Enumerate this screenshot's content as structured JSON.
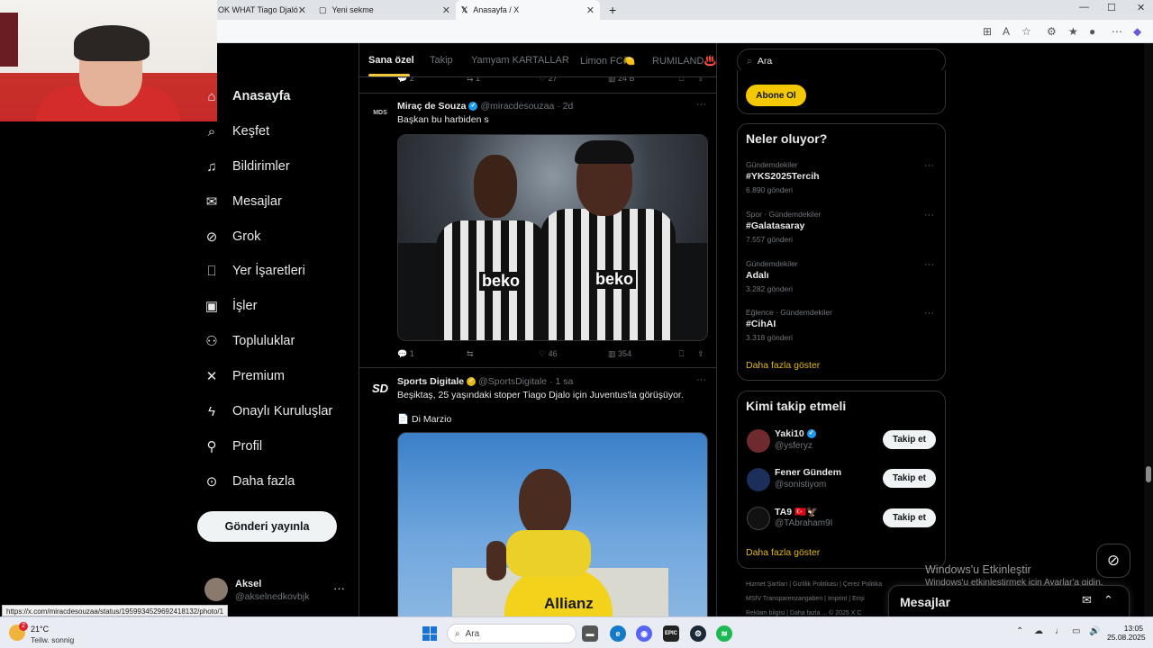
{
  "browser": {
    "tabs": [
      {
        "label": "OK WHAT Tiago Djaló is ..."
      },
      {
        "label": "Yeni sekme"
      },
      {
        "label": "Anasayfa / X"
      }
    ],
    "new_tab": "+",
    "window_controls": [
      "—",
      "☐",
      "✕"
    ]
  },
  "sidebar": {
    "logo": "X",
    "items": [
      {
        "label": "Anasayfa",
        "icon": "home-icon"
      },
      {
        "label": "Keşfet",
        "icon": "search-icon"
      },
      {
        "label": "Bildirimler",
        "icon": "bell-icon"
      },
      {
        "label": "Mesajlar",
        "icon": "mail-icon"
      },
      {
        "label": "Grok",
        "icon": "grok-icon"
      },
      {
        "label": "Yer İşaretleri",
        "icon": "bookmark-icon"
      },
      {
        "label": "İşler",
        "icon": "briefcase-icon"
      },
      {
        "label": "Topluluklar",
        "icon": "people-icon"
      },
      {
        "label": "Premium",
        "icon": "x-logo-icon"
      },
      {
        "label": "Onaylı Kuruluşlar",
        "icon": "lightning-icon"
      },
      {
        "label": "Profil",
        "icon": "person-icon"
      },
      {
        "label": "Daha fazla",
        "icon": "more-circle-icon"
      }
    ],
    "post_button": "Gönderi yayınla",
    "account": {
      "name": "Aksel",
      "handle": "@akselnedkovbjk",
      "more": "···"
    }
  },
  "status_url": "https://x.com/miracdesouzaa/status/1959934529692418132/photo/1",
  "feed": {
    "tabs": [
      {
        "label": "Sana özel",
        "active": true
      },
      {
        "label": "Takip"
      },
      {
        "label": "Yamyam KARTALLAR"
      },
      {
        "label": "Limon FC🍋"
      },
      {
        "label": "RUMILAND♨️"
      }
    ],
    "prev_actions": {
      "replies": "2",
      "reposts": "1",
      "likes": "27",
      "views": "24 B"
    },
    "tweets": [
      {
        "avatar": "MDS",
        "name": "Miraç de Souza",
        "handle": "@miracdesouzaa",
        "time": "2d",
        "text": "Başkan bu harbiden s",
        "actions": {
          "replies": "1",
          "reposts": "",
          "likes": "46",
          "views": "354"
        }
      },
      {
        "avatar": "SD",
        "name": "Sports Digitale",
        "handle": "@SportsDigitale",
        "time": "1 sa",
        "text": "Beşiktaş, 25 yaşındaki stoper Tiago Djalo için Juventus'la görüşüyor.",
        "source": "📄 Di Marzio"
      }
    ],
    "media_text": {
      "sponsor": "beko",
      "sponsor2": "beko",
      "j_sponsor": "Allianz"
    }
  },
  "right": {
    "search_placeholder": "Ara",
    "subscribe_button": "Abone Ol",
    "trends_title": "Neler oluyor?",
    "trends": [
      {
        "category": "Gündemdekiler",
        "name": "#YKS2025Tercih",
        "count": "6.890 gönderi"
      },
      {
        "category": "Spor · Gündemdekiler",
        "name": "#Galatasaray",
        "count": "7.557 gönderi"
      },
      {
        "category": "Gündemdekiler",
        "name": "Adalı",
        "count": "3.282 gönderi"
      },
      {
        "category": "Eğlence · Gündemdekiler",
        "name": "#CihAI",
        "count": "3.318 gönderi"
      }
    ],
    "show_more": "Daha fazla göster",
    "wtf_title": "Kimi takip etmeli",
    "who_to_follow": [
      {
        "name": "Yaki10",
        "handle": "@ysferyz",
        "verified": true,
        "avatar_color": "#6e2a2f"
      },
      {
        "name": "Fener Gündem",
        "handle": "@sonistiyom",
        "verified": false,
        "avatar_color": "#1c2f5a"
      },
      {
        "name": "TA9 🇹🇷🦅",
        "handle": "@TAbraham9I",
        "verified": false,
        "avatar_color": "#111111"
      }
    ],
    "follow_label": "Takip et",
    "footer": [
      "Hizmet Şartları",
      "Gizlilik Politikası",
      "Çerez Politika",
      "MSfV Transparenzangaben",
      "Imprint",
      "Erişi",
      "Reklam bilgisi",
      "Daha fazla ...",
      "© 2025 X C"
    ],
    "windows_activation": {
      "title": "Windows'u Etkinleştir",
      "subtitle": "Windows'u etkinleştirmek için Ayarlar'a gidin."
    },
    "messages_drawer": "Mesajlar"
  },
  "taskbar": {
    "weather": {
      "temp": "21°C",
      "desc": "Teilw. sonnig",
      "badge": "2"
    },
    "search": "Ara",
    "time": "13:05",
    "date": "25.08.2025"
  },
  "colors": {
    "accent": "#f3c93e",
    "verified_blue": "#1d9bf0",
    "verified_gold": "#e2b719",
    "background": "#000000",
    "border": "#2f3336"
  }
}
